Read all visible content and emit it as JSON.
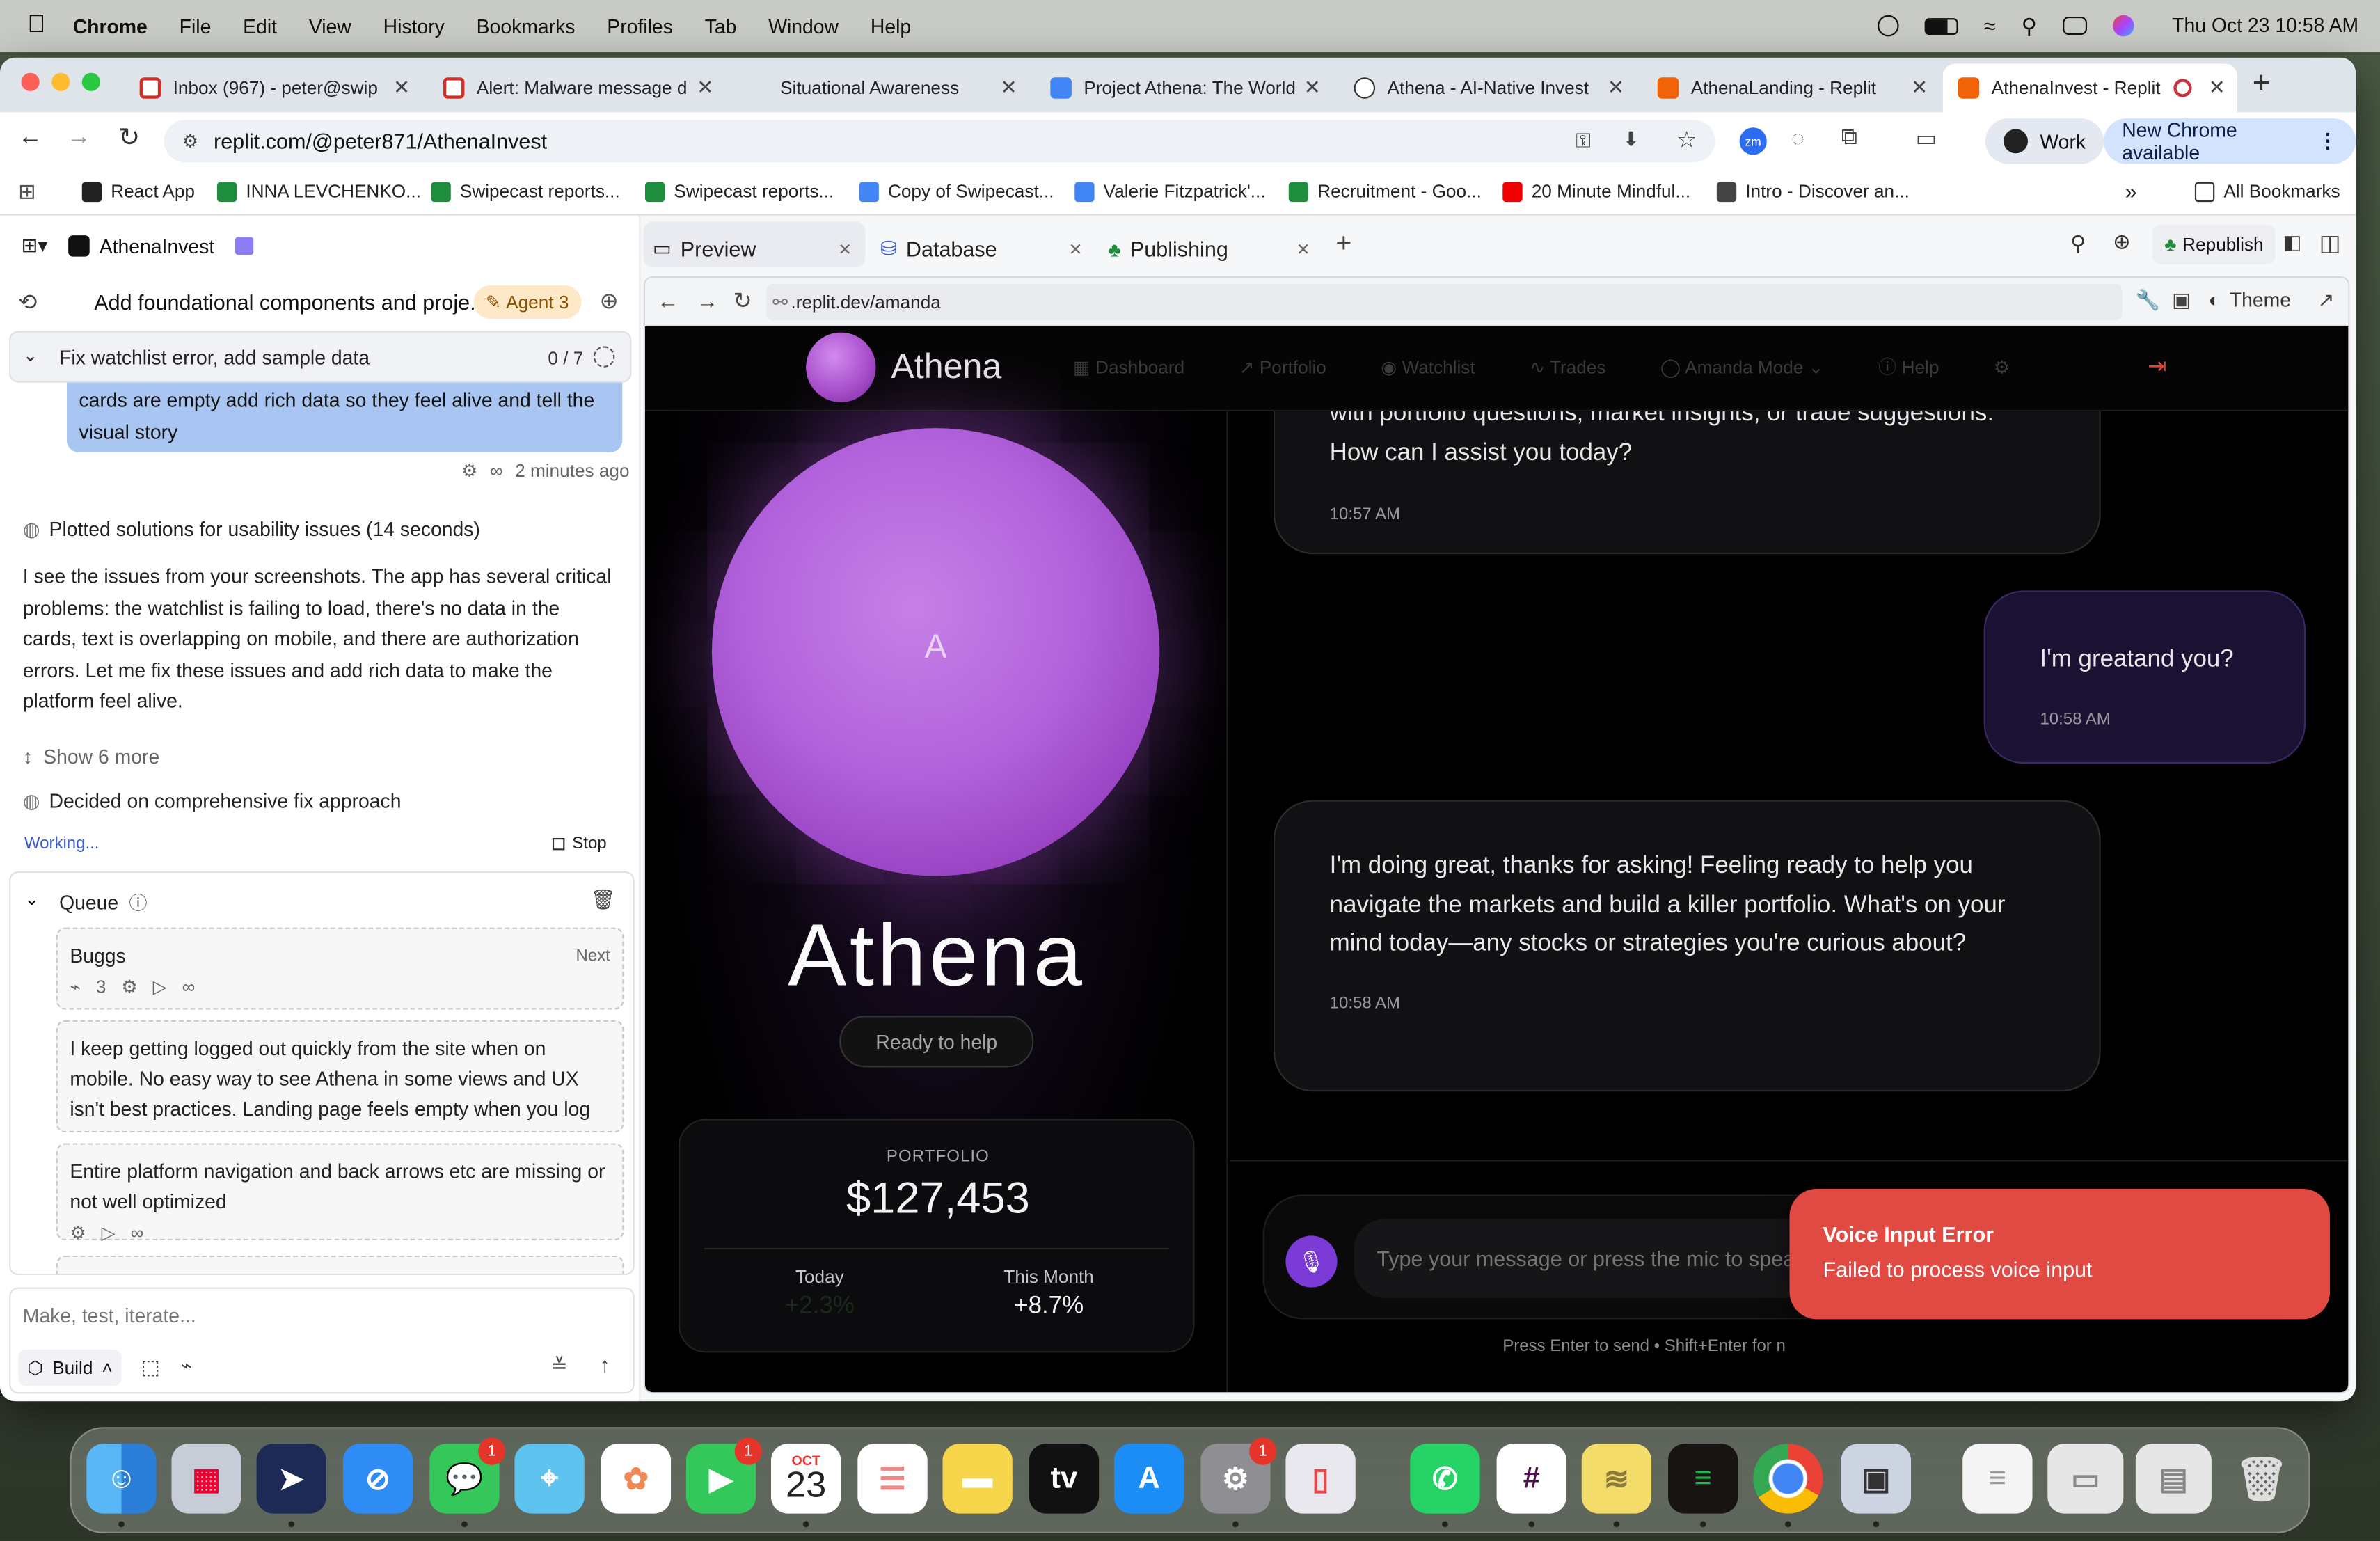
{
  "menubar": {
    "app": "Chrome",
    "items": [
      "File",
      "Edit",
      "View",
      "History",
      "Bookmarks",
      "Profiles",
      "Tab",
      "Window",
      "Help"
    ],
    "datetime": "Thu Oct 23  10:58 AM"
  },
  "tabs": [
    {
      "title": "Inbox (967) - peter@swip",
      "color": "#d93025"
    },
    {
      "title": "Alert: Malware message d",
      "color": "#d93025"
    },
    {
      "title": "Situational Awareness",
      "color": "#ffffff"
    },
    {
      "title": "Project Athena: The World",
      "color": "#4285f4"
    },
    {
      "title": "Athena - AI-Native Invest",
      "color": "#333333"
    },
    {
      "title": "AthenaLanding - Replit",
      "color": "#f26207"
    },
    {
      "title": "AthenaInvest - Replit",
      "color": "#f26207"
    }
  ],
  "address": {
    "url": "replit.com/@peter871/AthenaInvest",
    "profile": "Work",
    "update_button": "New Chrome available"
  },
  "bookmarks": {
    "items": [
      "React App",
      "INNA LEVCHENKO...",
      "Swipecast reports...",
      "Swipecast reports...",
      "Copy of Swipecast...",
      "Valerie Fitzpatrick'...",
      "Recruitment - Goo...",
      "20 Minute Mindful...",
      "Intro - Discover an..."
    ],
    "all": "All Bookmarks"
  },
  "replit": {
    "project": "AthenaInvest",
    "thread_title": "Add foundational components and proje...",
    "agent_badge": "Agent 3",
    "checklist_title": "Fix watchlist error, add sample data",
    "checklist_count": "0 / 7",
    "user_msg": "cards are empty add rich data so they feel alive and tell the visual story",
    "user_msg_time": "2 minutes ago",
    "plotted": "Plotted solutions for usability issues (14 seconds)",
    "agent_text": "I see the issues from your screenshots. The app has several critical problems: the watchlist is failing to load, there's no data in the cards, text is overlapping on mobile, and there are authorization errors. Let me fix these issues and add rich data to make the platform feel alive.",
    "show_more": "Show 6 more",
    "decided": "Decided on comprehensive fix approach",
    "working": "Working...",
    "stop": "Stop",
    "queue": {
      "title": "Queue",
      "items": [
        {
          "title": "Buggs",
          "next": "Next",
          "attachments": "3"
        },
        {
          "text": "I keep getting logged out quickly from the site when on mobile. No easy way to see Athena in some views and UX isn't best practices. Landing page feels empty when you log ..."
        },
        {
          "text": "Entire platform navigation and back arrows etc are missing or not well optimized"
        }
      ]
    },
    "input_placeholder": "Make, test, iterate...",
    "build": "Build",
    "panel_tabs": [
      "Preview",
      "Database",
      "Publishing"
    ],
    "republish": "Republish",
    "preview_url": ".replit.dev/amanda",
    "theme": "Theme"
  },
  "athena": {
    "brand": "Athena",
    "nav": [
      "Dashboard",
      "Portfolio",
      "Watchlist",
      "Trades",
      "Amanda Mode",
      "Help"
    ],
    "orb_letter": "A",
    "hero_name": "Athena",
    "status": "Ready to help",
    "portfolio_label": "PORTFOLIO",
    "portfolio_value": "$127,453",
    "today_label": "Today",
    "today_value": "+2.3%",
    "month_label": "This Month",
    "month_value": "+8.7%",
    "messages": [
      {
        "from": "assistant",
        "text": "with portfolio questions, market insights, or trade suggestions. How can I assist you today?",
        "time": "10:57 AM"
      },
      {
        "from": "user",
        "text": "I'm greatand you?",
        "time": "10:58 AM"
      },
      {
        "from": "assistant",
        "text": "I'm doing great, thanks for asking! Feeling ready to help you navigate the markets and build a killer portfolio. What's on your mind today—any stocks or strategies you're curious about?",
        "time": "10:58 AM"
      }
    ],
    "input_placeholder": "Type your message or press the mic to speak...",
    "hint": "Press Enter to send • Shift+Enter for n",
    "toast_title": "Voice Input Error",
    "toast_body": "Failed to process voice input"
  },
  "dock": {
    "calendar_month": "OCT",
    "calendar_day": "23",
    "messages_badge": "1",
    "facetime_badge": "1",
    "settings_badge": "1"
  }
}
